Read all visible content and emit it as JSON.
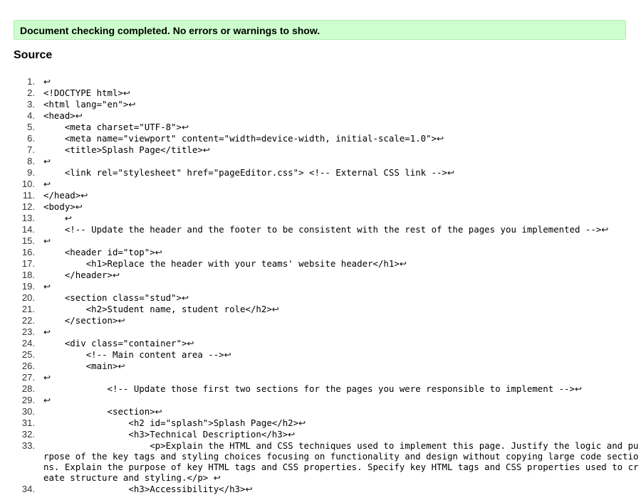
{
  "status_message": "Document checking completed. No errors or warnings to show.",
  "source_heading": "Source",
  "return_symbol": "↩",
  "lines": [
    {
      "n": "1.",
      "code": ""
    },
    {
      "n": "2.",
      "code": "<!DOCTYPE html>"
    },
    {
      "n": "3.",
      "code": "<html lang=\"en\">"
    },
    {
      "n": "4.",
      "code": "<head>"
    },
    {
      "n": "5.",
      "code": "    <meta charset=\"UTF-8\">"
    },
    {
      "n": "6.",
      "code": "    <meta name=\"viewport\" content=\"width=device-width, initial-scale=1.0\">"
    },
    {
      "n": "7.",
      "code": "    <title>Splash Page</title>"
    },
    {
      "n": "8.",
      "code": ""
    },
    {
      "n": "9.",
      "code": "    <link rel=\"stylesheet\" href=\"pageEditor.css\"> <!-- External CSS link -->"
    },
    {
      "n": "10.",
      "code": ""
    },
    {
      "n": "11.",
      "code": "</head>"
    },
    {
      "n": "12.",
      "code": "<body>"
    },
    {
      "n": "13.",
      "code": "    "
    },
    {
      "n": "14.",
      "code": "    <!-- Update the header and the footer to be consistent with the rest of the pages you implemented -->"
    },
    {
      "n": "15.",
      "code": ""
    },
    {
      "n": "16.",
      "code": "    <header id=\"top\">"
    },
    {
      "n": "17.",
      "code": "        <h1>Replace the header with your teams' website header</h1>"
    },
    {
      "n": "18.",
      "code": "    </header>"
    },
    {
      "n": "19.",
      "code": ""
    },
    {
      "n": "20.",
      "code": "    <section class=\"stud\">"
    },
    {
      "n": "21.",
      "code": "        <h2>Student name, student role</h2>"
    },
    {
      "n": "22.",
      "code": "    </section>"
    },
    {
      "n": "23.",
      "code": ""
    },
    {
      "n": "24.",
      "code": "    <div class=\"container\">"
    },
    {
      "n": "25.",
      "code": "        <!-- Main content area -->"
    },
    {
      "n": "26.",
      "code": "        <main>"
    },
    {
      "n": "27.",
      "code": ""
    },
    {
      "n": "28.",
      "code": "            <!-- Update those first two sections for the pages you were responsible to implement -->"
    },
    {
      "n": "29.",
      "code": ""
    },
    {
      "n": "30.",
      "code": "            <section>"
    },
    {
      "n": "31.",
      "code": "                <h2 id=\"splash\">Splash Page</h2>"
    },
    {
      "n": "32.",
      "code": "                <h3>Technical Description</h3>"
    },
    {
      "n": "33.",
      "code": "                    <p>Explain the HTML and CSS techniques used to implement this page. Justify the logic and purpose of the key tags and styling choices focusing on functionality and design without copying large code sections. Explain the purpose of key HTML tags and CSS properties. Specify key HTML tags and CSS properties used to create structure and styling.</p> "
    },
    {
      "n": "34.",
      "code": "                <h3>Accessibility</h3>"
    }
  ]
}
